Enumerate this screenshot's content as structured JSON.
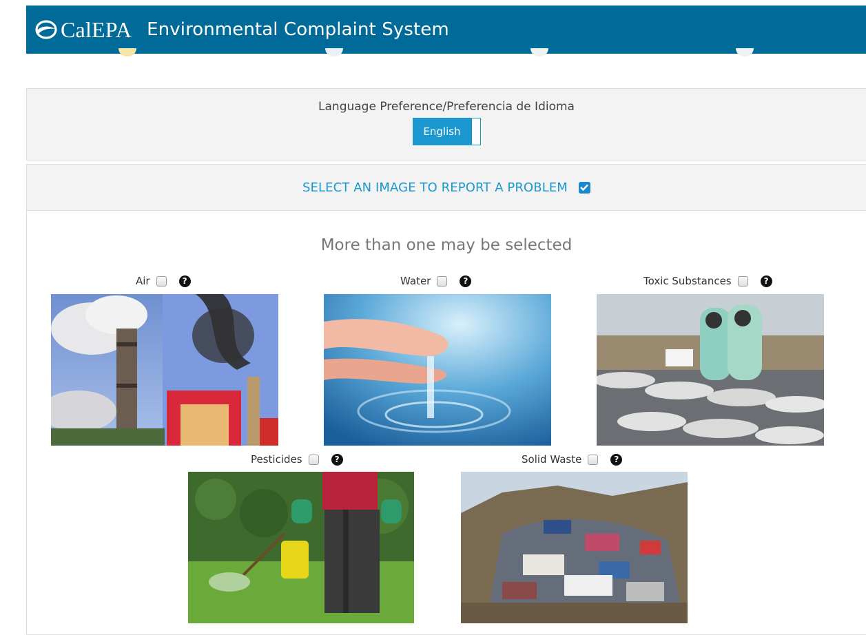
{
  "header": {
    "logo_text": "CalEPA",
    "title": "Environmental Complaint System"
  },
  "language": {
    "label": "Language Preference/Preferencia de Idioma",
    "selected": "English"
  },
  "report": {
    "heading": "SELECT AN IMAGE TO REPORT A PROBLEM",
    "subtitle": "More than one may be selected",
    "categories": [
      {
        "label": "Air",
        "checked": false,
        "image": "smokestacks-photo"
      },
      {
        "label": "Water",
        "checked": false,
        "image": "hands-in-water-photo"
      },
      {
        "label": "Toxic Substances",
        "checked": false,
        "image": "hazmat-drums-photo"
      },
      {
        "label": "Pesticides",
        "checked": false,
        "image": "sprayer-on-lawn-photo"
      },
      {
        "label": "Solid Waste",
        "checked": false,
        "image": "trash-pile-photo"
      }
    ]
  },
  "colors": {
    "header_bg": "#006a99",
    "accent": "#1a98cf"
  }
}
